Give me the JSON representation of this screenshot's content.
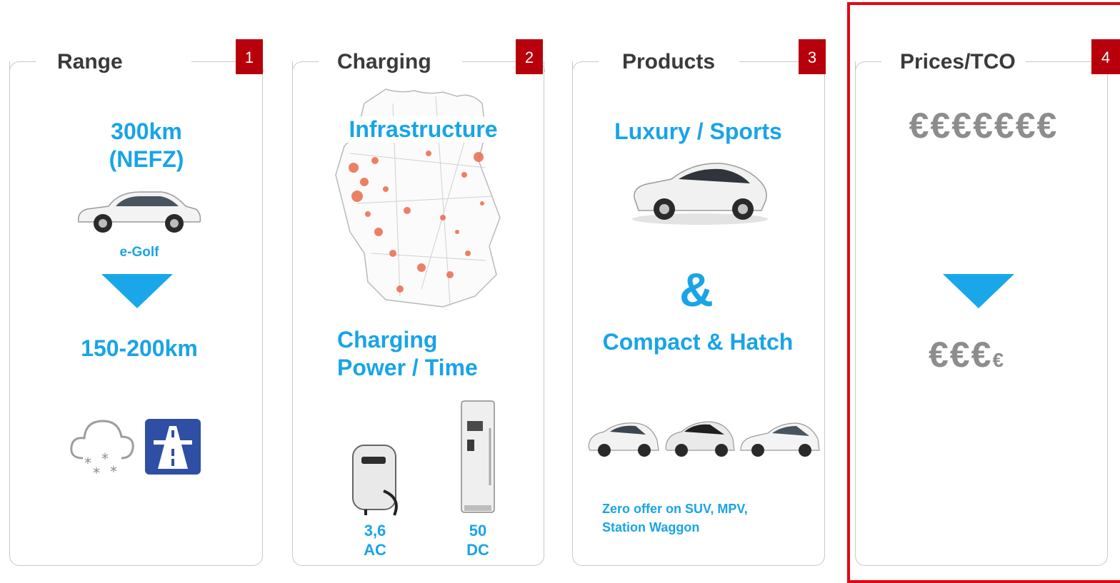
{
  "panels": [
    {
      "title": "Range",
      "number": "1",
      "headline": "300km\n(NEFZ)",
      "car_label": "e-Golf",
      "result": "150-200km",
      "icons": [
        "snow-cloud-icon",
        "motorway-icon"
      ]
    },
    {
      "title": "Charging",
      "number": "2",
      "infrastructure": "Infrastructure",
      "power": "Charging\nPower / Time",
      "ac_label": "3,6\nAC",
      "dc_label": "50\nDC",
      "icons": [
        "germany-map-icon",
        "wallbox-charger-icon",
        "dc-charger-icon"
      ]
    },
    {
      "title": "Products",
      "number": "3",
      "luxury": "Luxury / Sports",
      "ampersand": "&",
      "compact": "Compact & Hatch",
      "note": "Zero offer on SUV, MPV,\nStation Waggon",
      "icons": [
        "sports-car-icon",
        "compact-car-icon"
      ]
    },
    {
      "title": "Prices/TCO",
      "number": "4",
      "prices_high": "€€€€€€€",
      "prices_low": "€€€",
      "prices_low_small": "€",
      "highlight_color": "#e30613"
    }
  ],
  "colors": {
    "accent": "#19a4e7",
    "badge": "#b7000c",
    "border": "#c8c8c8",
    "highlight": "#e30613"
  }
}
